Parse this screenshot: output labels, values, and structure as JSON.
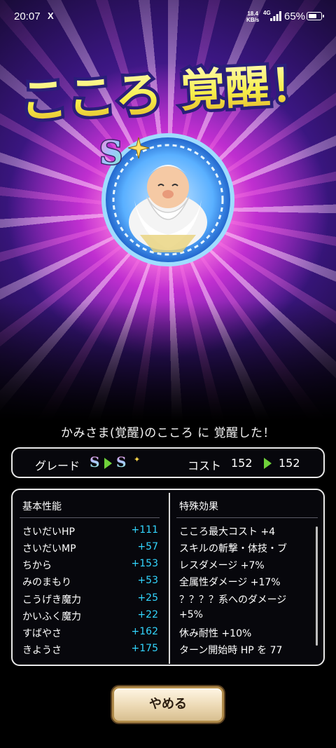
{
  "status_bar": {
    "time": "20:07",
    "x_icon": "X",
    "net_rate_top": "18.4",
    "net_rate_bottom": "KB/s",
    "network": "4G",
    "battery": "65%"
  },
  "title": {
    "kokoro": "こころ",
    "kakusei": "覚醒！",
    "fill_color": "#f6ee4a",
    "outline_color": "#2a1e7a"
  },
  "medal": {
    "grade_badge": "S",
    "icon": "sage-portrait-medal"
  },
  "message": "かみさま(覚醒)のこころ に 覚醒した！",
  "grade": {
    "label": "グレード",
    "from": "S",
    "to": "S",
    "cost_label": "コスト",
    "cost_before": "152",
    "cost_after": "152",
    "arrow_color": "#6fd13a"
  },
  "basic": {
    "header": "基本性能",
    "rows": [
      {
        "name": "さいだいHP",
        "value": "+111"
      },
      {
        "name": "さいだいMP",
        "value": "+57"
      },
      {
        "name": "ちから",
        "value": "+153"
      },
      {
        "name": "みのまもり",
        "value": "+53"
      },
      {
        "name": "こうげき魔力",
        "value": "+25"
      },
      {
        "name": "かいふく魔力",
        "value": "+22"
      },
      {
        "name": "すばやさ",
        "value": "+162"
      },
      {
        "name": "きようさ",
        "value": "+175"
      }
    ],
    "value_color": "#33d6ff"
  },
  "special": {
    "header": "特殊効果",
    "lines": [
      "こころ最大コスト +4",
      "スキルの斬撃・体技・ブ",
      "レスダメージ +7%",
      "全属性ダメージ +17%",
      "？？？？系へのダメージ",
      "+5%",
      "休み耐性 +10%",
      "ターン開始時 HP を 77"
    ]
  },
  "quit_button": "やめる"
}
